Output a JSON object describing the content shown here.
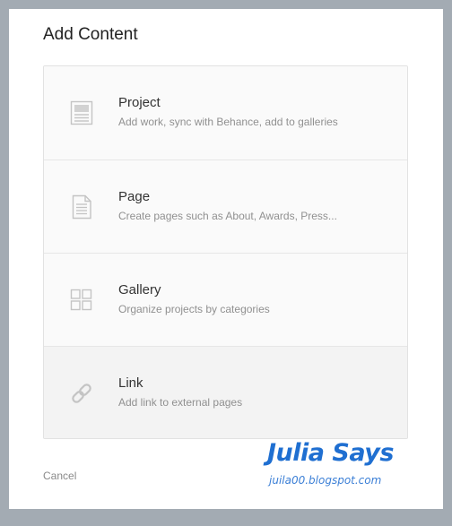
{
  "dialog": {
    "title": "Add Content",
    "options": [
      {
        "icon": "project-icon",
        "name": "Project",
        "description": "Add work, sync with Behance, add to galleries"
      },
      {
        "icon": "page-icon",
        "name": "Page",
        "description": "Create pages such as About, Awards, Press..."
      },
      {
        "icon": "gallery-grid-icon",
        "name": "Gallery",
        "description": "Organize projects by categories"
      },
      {
        "icon": "link-icon",
        "name": "Link",
        "description": "Add link to external pages"
      }
    ],
    "cancel_label": "Cancel"
  },
  "watermark": {
    "title": "Julia Says",
    "url": "juila00.blogspot.com"
  },
  "colors": {
    "backdrop": "#a3abb3",
    "hovered_option": "#f3f3f3",
    "watermark": "#1f6fd1"
  }
}
